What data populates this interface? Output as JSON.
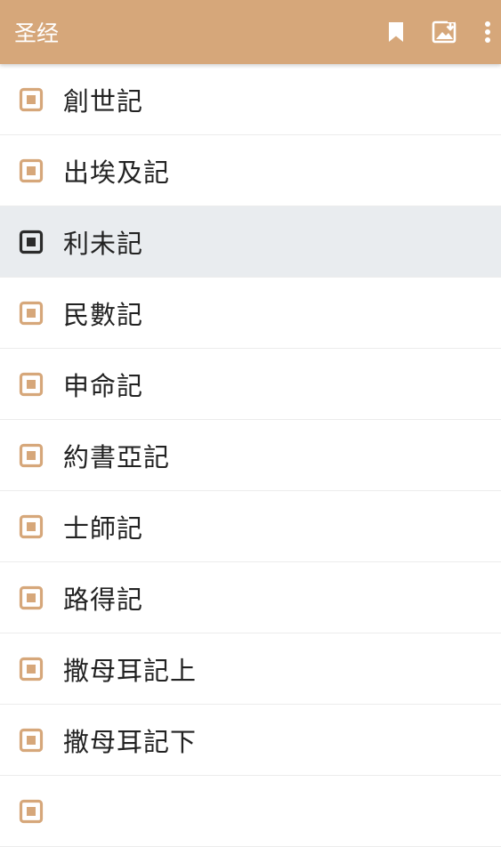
{
  "appbar": {
    "title": "圣经",
    "bookmark_icon": "bookmark-icon",
    "export_icon": "image-export-icon",
    "more_icon": "more-vert-icon"
  },
  "colors": {
    "accent": "#d6a77a",
    "selected_row_bg": "#e9ecef",
    "selected_icon": "#2b2b2b"
  },
  "books": [
    {
      "label": "創世記",
      "selected": false
    },
    {
      "label": "出埃及記",
      "selected": false
    },
    {
      "label": "利未記",
      "selected": true
    },
    {
      "label": "民數記",
      "selected": false
    },
    {
      "label": "申命記",
      "selected": false
    },
    {
      "label": "約書亞記",
      "selected": false
    },
    {
      "label": "士師記",
      "selected": false
    },
    {
      "label": "路得記",
      "selected": false
    },
    {
      "label": "撒母耳記上",
      "selected": false
    },
    {
      "label": "撒母耳記下",
      "selected": false
    },
    {
      "label": "",
      "selected": false
    }
  ]
}
